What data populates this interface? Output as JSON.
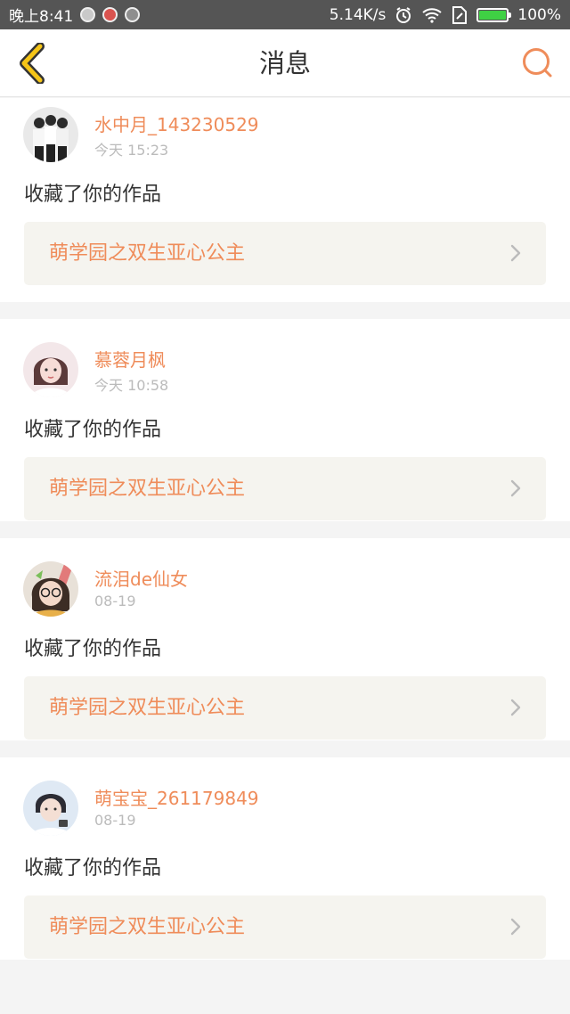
{
  "status_bar": {
    "time": "晚上8:41",
    "network_speed": "5.14K/s",
    "battery": "100%",
    "battery_level": 1.0,
    "notification_icons": [
      "app-notification-icon",
      "app-notification-icon",
      "app-notification-icon"
    ],
    "right_icons": [
      "alarm-icon",
      "wifi-icon",
      "sim-icon",
      "battery-icon"
    ]
  },
  "nav": {
    "title": "消息",
    "back_icon": "chevron-left-icon",
    "search_icon": "search-icon",
    "accent": "#f5c518",
    "search_color": "#ef8c5a"
  },
  "messages": [
    {
      "user": "水中月_143230529",
      "time": "今天 15:23",
      "action": "收藏了你的作品",
      "work": "萌学园之双生亚心公主"
    },
    {
      "user": "慕蓉月枫",
      "time": "今天 10:58",
      "action": "收藏了你的作品",
      "work": "萌学园之双生亚心公主"
    },
    {
      "user": "流泪de仙女",
      "time": "08-19",
      "action": "收藏了你的作品",
      "work": "萌学园之双生亚心公主"
    },
    {
      "user": "萌宝宝_261179849",
      "time": "08-19",
      "action": "收藏了你的作品",
      "work": "萌学园之双生亚心公主"
    }
  ],
  "colors": {
    "username": "#ef8c5a",
    "work_title": "#ef8c5a",
    "timestamp": "#bbbbbb",
    "card_link_bg": "#f5f4ef"
  }
}
